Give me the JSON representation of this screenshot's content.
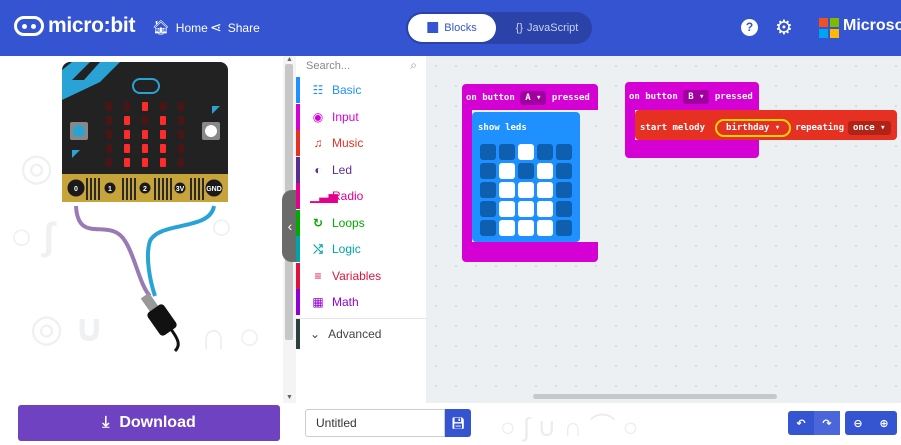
{
  "header": {
    "brand": "micro:bit",
    "home_label": "Home",
    "share_label": "Share",
    "blocks_label": "Blocks",
    "javascript_label": "JavaScript",
    "microsoft_label": "Microsoft"
  },
  "simulator": {
    "pins": [
      "0",
      "1",
      "2",
      "3V",
      "GND"
    ]
  },
  "toolbox": {
    "search_placeholder": "Search...",
    "categories": [
      {
        "label": "Basic",
        "color": "#1e90ff",
        "icon": "grid-icon",
        "glyph": "☷"
      },
      {
        "label": "Input",
        "color": "#d400d4",
        "icon": "target-icon",
        "glyph": "◉"
      },
      {
        "label": "Music",
        "color": "#e63022",
        "icon": "headphones-icon",
        "glyph": "♫"
      },
      {
        "label": "Led",
        "color": "#5c2d91",
        "icon": "toggle-icon",
        "glyph": "◐"
      },
      {
        "label": "Radio",
        "color": "#e3008c",
        "icon": "signal-bars-icon",
        "glyph": "▁▃▅"
      },
      {
        "label": "Loops",
        "color": "#00aa00",
        "icon": "refresh-icon",
        "glyph": "↻"
      },
      {
        "label": "Logic",
        "color": "#00a4a6",
        "icon": "shuffle-icon",
        "glyph": "⤭"
      },
      {
        "label": "Variables",
        "color": "#dc143c",
        "icon": "list-icon",
        "glyph": "≡"
      },
      {
        "label": "Math",
        "color": "#9400d3",
        "icon": "calculator-icon",
        "glyph": "▦"
      }
    ],
    "advanced_label": "Advanced"
  },
  "workspace": {
    "event_a": {
      "prefix": "on button",
      "button": "A",
      "suffix": "pressed",
      "color": "#d400d4"
    },
    "show_leds": {
      "label": "show leds",
      "color": "#1e90ff",
      "grid": [
        [
          0,
          0,
          1,
          0,
          0
        ],
        [
          0,
          1,
          0,
          1,
          0
        ],
        [
          0,
          1,
          1,
          1,
          0
        ],
        [
          0,
          1,
          1,
          1,
          0
        ],
        [
          0,
          1,
          1,
          1,
          0
        ]
      ]
    },
    "event_b": {
      "prefix": "on button",
      "button": "B",
      "suffix": "pressed",
      "color": "#d400d4"
    },
    "melody": {
      "label": "start melody",
      "melody": "birthday",
      "repeat_label": "repeating",
      "repeat": "once",
      "color": "#e63022"
    }
  },
  "footer": {
    "download_label": "Download",
    "project_name": "Untitled"
  },
  "colors": {
    "primary": "#3454d1",
    "download": "#6f42c1"
  }
}
